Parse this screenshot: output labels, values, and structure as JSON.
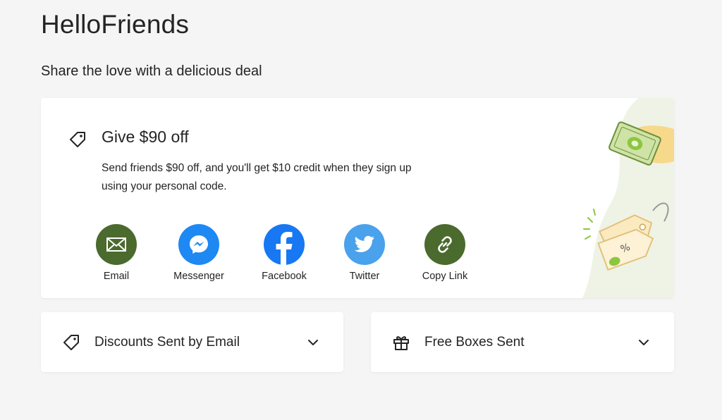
{
  "page": {
    "title": "HelloFriends",
    "subtitle": "Share the love with a delicious deal"
  },
  "offer": {
    "title": "Give $90 off",
    "description": "Send friends $90 off, and you'll get $10 credit when they sign up using your personal code.",
    "icon": "tag-icon"
  },
  "share_options": [
    {
      "label": "Email",
      "icon": "envelope-icon",
      "color": "#4b6a2e"
    },
    {
      "label": "Messenger",
      "icon": "messenger-icon",
      "color": "#1e88f3"
    },
    {
      "label": "Facebook",
      "icon": "facebook-icon",
      "color": "#1877f2"
    },
    {
      "label": "Twitter",
      "icon": "twitter-icon",
      "color": "#4aa1ec"
    },
    {
      "label": "Copy Link",
      "icon": "link-icon",
      "color": "#4b6a2e"
    }
  ],
  "panels": [
    {
      "label": "Discounts Sent by Email",
      "icon": "tag-icon"
    },
    {
      "label": "Free Boxes Sent",
      "icon": "gift-icon"
    }
  ],
  "colors": {
    "brand_green": "#4b6a2e",
    "accent_lime": "#8cc63f",
    "background": "#f5f5f5"
  }
}
